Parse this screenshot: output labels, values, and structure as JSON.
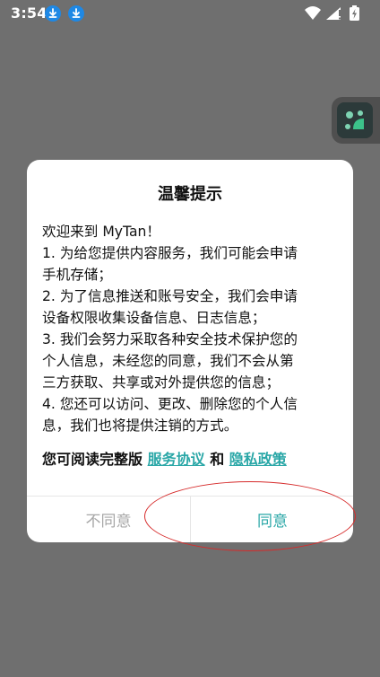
{
  "status_bar": {
    "time": "3:54",
    "icons": [
      "download-icon",
      "download-icon",
      "wifi-icon",
      "cellular-signal-icon",
      "battery-charging-icon"
    ]
  },
  "side_widget": {
    "icon": "app-shortcut-icon"
  },
  "dialog": {
    "title": "温馨提示",
    "lines": [
      "欢迎来到 MyTan！",
      " 1. 为给您提供内容服务，我们可能会申请",
      "手机存储；",
      " 2. 为了信息推送和账号安全，我们会申请",
      "设备权限收集设备信息、日志信息；",
      " 3. 我们会努力采取各种安全技术保护您的",
      "个人信息，未经您的同意，我们不会从第",
      "三方获取、共享或对外提供您的信息；",
      " 4. 您还可以访问、更改、删除您的个人信",
      "息，我们也将提供注销的方式。"
    ],
    "read_prefix": "您可阅读完整版",
    "service_link": "服务协议",
    "and_text": "和",
    "privacy_link": "隐私政策",
    "disagree_label": "不同意",
    "agree_label": "同意"
  },
  "colors": {
    "overlay": "#6f6f6f",
    "accent": "#2aa7a7",
    "annotation": "#d62b2b"
  }
}
